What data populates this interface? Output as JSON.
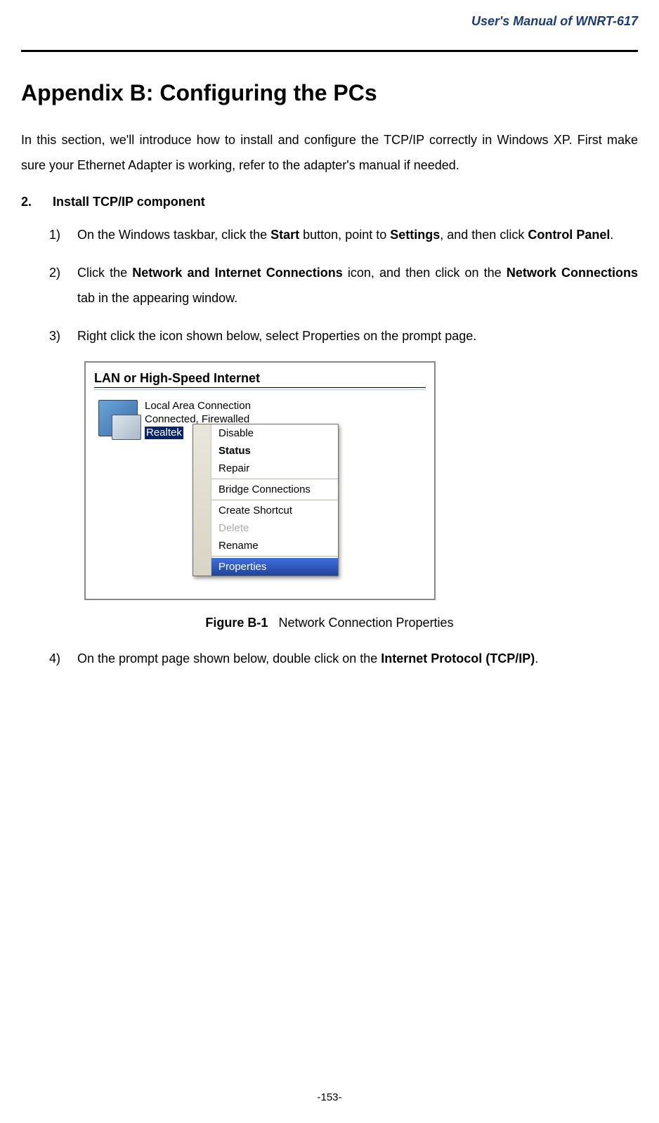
{
  "header": {
    "doc_title": "User's Manual of WNRT-617"
  },
  "title": "Appendix B: Configuring the PCs",
  "intro": "In this section, we'll introduce how to install and configure the TCP/IP correctly in Windows XP. First make sure your Ethernet Adapter is working, refer to the adapter's manual if needed.",
  "section": {
    "number": "2.",
    "title": "Install TCP/IP component"
  },
  "steps": {
    "s1": {
      "marker": "1)",
      "t1": "On the Windows taskbar, click the ",
      "b1": "Start",
      "t2": " button, point to ",
      "b2": "Settings",
      "t3": ", and then click ",
      "b3": "Control Panel",
      "t4": "."
    },
    "s2": {
      "marker": "2)",
      "t1": "Click the ",
      "b1": "Network and Internet Connections",
      "t2": " icon, and then click on the ",
      "b2": "Network Connections",
      "t3": " tab in the appearing window."
    },
    "s3": {
      "marker": "3)",
      "t1": "Right click the icon shown below, select Properties on the prompt page."
    },
    "s4": {
      "marker": "4)",
      "t1": "On the prompt page shown below, double click on the ",
      "b1": "Internet Protocol (TCP/IP)",
      "t2": "."
    }
  },
  "xp": {
    "group_title": "LAN or High-Speed Internet",
    "conn": {
      "line1": "Local Area Connection",
      "line2": "Connected, Firewalled",
      "line3": "Realtek"
    },
    "menu": {
      "disable": "Disable",
      "status": "Status",
      "repair": "Repair",
      "bridge": "Bridge Connections",
      "shortcut": "Create Shortcut",
      "delete": "Delete",
      "rename": "Rename",
      "properties": "Properties"
    }
  },
  "figure": {
    "label": "Figure B-1",
    "caption": "Network Connection Properties"
  },
  "page_number": "-153-"
}
